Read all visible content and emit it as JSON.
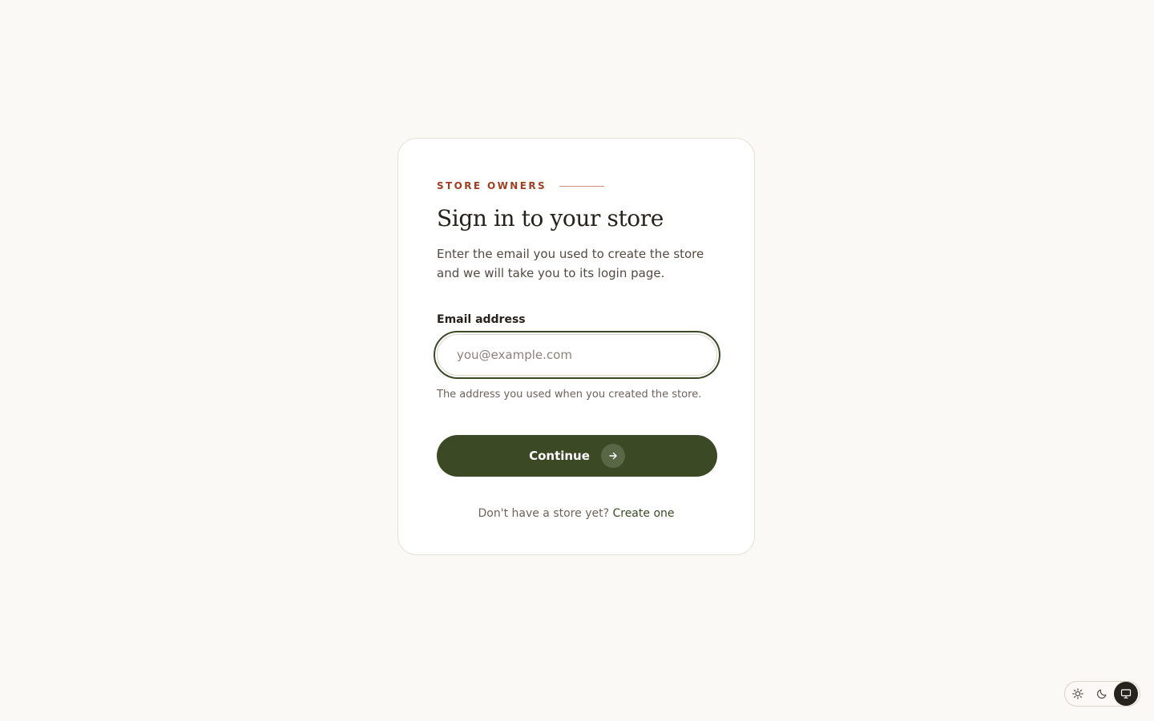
{
  "eyebrow": "STORE OWNERS",
  "title": "Sign in to your store",
  "subtitle": "Enter the email you used to create the store and we will take you to its login page.",
  "email": {
    "label": "Email address",
    "value": "",
    "placeholder": "you@example.com",
    "hint": "The address you used when you created the store."
  },
  "continue_label": "Continue",
  "footer": {
    "prompt": "Don't have a store yet?",
    "link_label": "Create one"
  },
  "theme_switch": {
    "options": [
      "sun-icon",
      "moon-icon",
      "monitor-icon"
    ],
    "selected": "monitor-icon"
  },
  "colors": {
    "accent": "#3b4a24",
    "eyebrow": "#a23e1f",
    "background": "#faf9f6"
  }
}
